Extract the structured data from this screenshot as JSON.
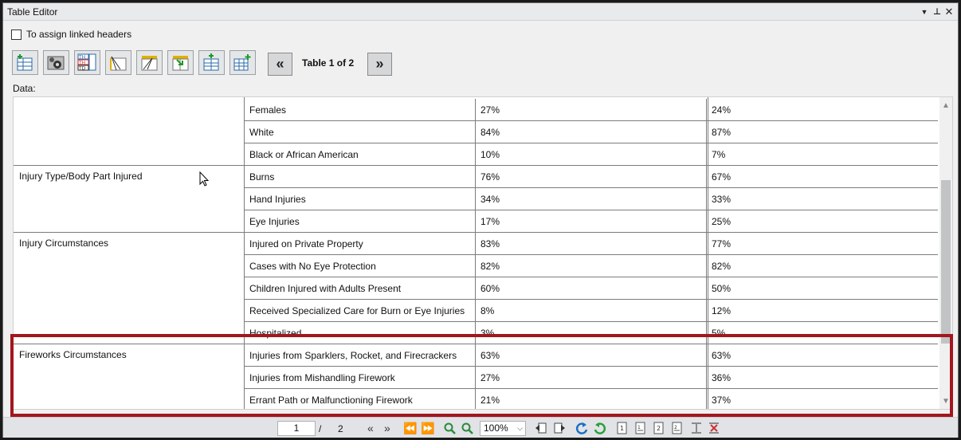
{
  "window": {
    "title": "Table Editor",
    "dropdown_glyph": "▼",
    "pin_glyph": "⊥",
    "close_glyph": "✕"
  },
  "options": {
    "linked_headers_label": "To assign linked headers",
    "linked_headers_checked": false
  },
  "toolbar": {
    "tools": [
      "insert-row-icon",
      "table-settings-icon",
      "header-types-icon",
      "split-cell-icon",
      "diagonal-header-icon",
      "merge-cells-icon",
      "add-row-icon",
      "add-column-icon"
    ],
    "prev_table": "«",
    "next_table": "»",
    "table_counter": "Table 1 of 2"
  },
  "data_label": "Data:",
  "table": {
    "groups": [
      {
        "name": "",
        "rows": [
          [
            "Females",
            "27%",
            "24%"
          ],
          [
            "White",
            "84%",
            "87%"
          ],
          [
            "Black or African American",
            "10%",
            "7%"
          ]
        ]
      },
      {
        "name": "Injury Type/Body Part Injured",
        "rows": [
          [
            "Burns",
            "76%",
            "67%"
          ],
          [
            "Hand Injuries",
            "34%",
            "33%"
          ],
          [
            "Eye Injuries",
            "17%",
            "25%"
          ]
        ]
      },
      {
        "name": "Injury Circumstances",
        "rows": [
          [
            "Injured on Private Property",
            "83%",
            "77%"
          ],
          [
            "Cases with No Eye Protection",
            "82%",
            "82%"
          ],
          [
            "Children Injured with Adults Present",
            "60%",
            "50%"
          ],
          [
            "Received Specialized Care for Burn or Eye Injuries",
            "8%",
            "12%"
          ],
          [
            "Hospitalized",
            "3%",
            "5%"
          ]
        ]
      },
      {
        "name": "Fireworks Circumstances",
        "rows": [
          [
            "Injuries from Sparklers, Rocket, and Firecrackers",
            "63%",
            "63%"
          ],
          [
            "Injuries from Mishandling Firework",
            "27%",
            "36%"
          ],
          [
            "Errant Path or Malfunctioning Firework",
            "21%",
            "37%"
          ]
        ]
      }
    ]
  },
  "pager": {
    "current_page": "1",
    "separator": "/",
    "total_pages": "2",
    "first": "«",
    "last": "»",
    "prev": "⏪",
    "next": "⏩",
    "zoom": "100%",
    "zoom_arrow": "⌵"
  },
  "colors": {
    "highlight": "#a3161e",
    "grid_line": "#7c7c7c"
  }
}
